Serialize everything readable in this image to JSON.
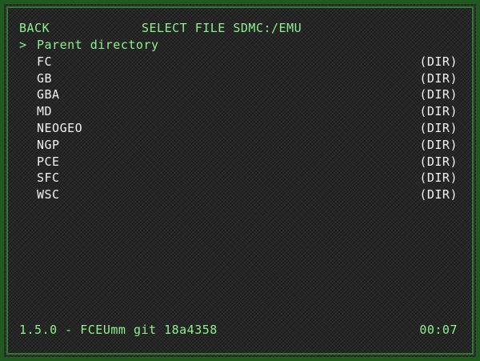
{
  "header": {
    "back_label": "BACK",
    "title": "SELECT FILE SDMC:/EMU"
  },
  "cursor_symbol": ">",
  "entries": [
    {
      "name": "Parent directory",
      "tag": "",
      "selected": true
    },
    {
      "name": "FC",
      "tag": "(DIR)",
      "selected": false
    },
    {
      "name": "GB",
      "tag": "(DIR)",
      "selected": false
    },
    {
      "name": "GBA",
      "tag": "(DIR)",
      "selected": false
    },
    {
      "name": "MD",
      "tag": "(DIR)",
      "selected": false
    },
    {
      "name": "NEOGEO",
      "tag": "(DIR)",
      "selected": false
    },
    {
      "name": "NGP",
      "tag": "(DIR)",
      "selected": false
    },
    {
      "name": "PCE",
      "tag": "(DIR)",
      "selected": false
    },
    {
      "name": "SFC",
      "tag": "(DIR)",
      "selected": false
    },
    {
      "name": "WSC",
      "tag": "(DIR)",
      "selected": false
    }
  ],
  "footer": {
    "version": "1.5.0 - FCEUmm git 18a4358",
    "clock": "00:07"
  },
  "colors": {
    "accent": "#8ef08e",
    "text": "#f2f2f2",
    "frame": "#2e7a2e"
  }
}
